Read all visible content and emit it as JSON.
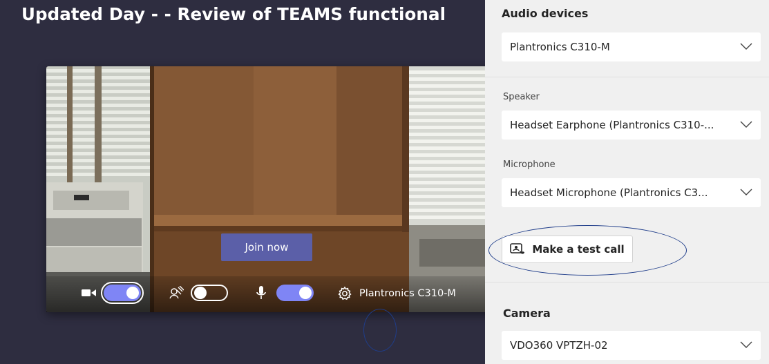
{
  "meeting": {
    "title": "Updated Day - - Review of TEAMS functional"
  },
  "preview": {
    "join_label": "Join now",
    "controls": {
      "camera_on": true,
      "blur_on": false,
      "mic_on": true,
      "device_label": "Plantronics C310-M"
    }
  },
  "panel": {
    "title": "Audio devices",
    "audio_device": "Plantronics C310-M",
    "speaker_label": "Speaker",
    "speaker_value": "Headset Earphone (Plantronics C310-...",
    "microphone_label": "Microphone",
    "microphone_value": "Headset Microphone (Plantronics C3...",
    "test_call_label": "Make a test call",
    "camera_title": "Camera",
    "camera_value": "VDO360 VPTZH-02"
  },
  "icons": {
    "camera": "video-camera-icon",
    "blur": "background-blur-icon",
    "mic": "microphone-icon",
    "settings": "gear-icon",
    "test_call": "test-call-icon",
    "chevron": "chevron-down-icon"
  },
  "colors": {
    "accent": "#5b5fa8",
    "toggle_on": "#7f85f5",
    "annotation": "#1f3d8a"
  }
}
